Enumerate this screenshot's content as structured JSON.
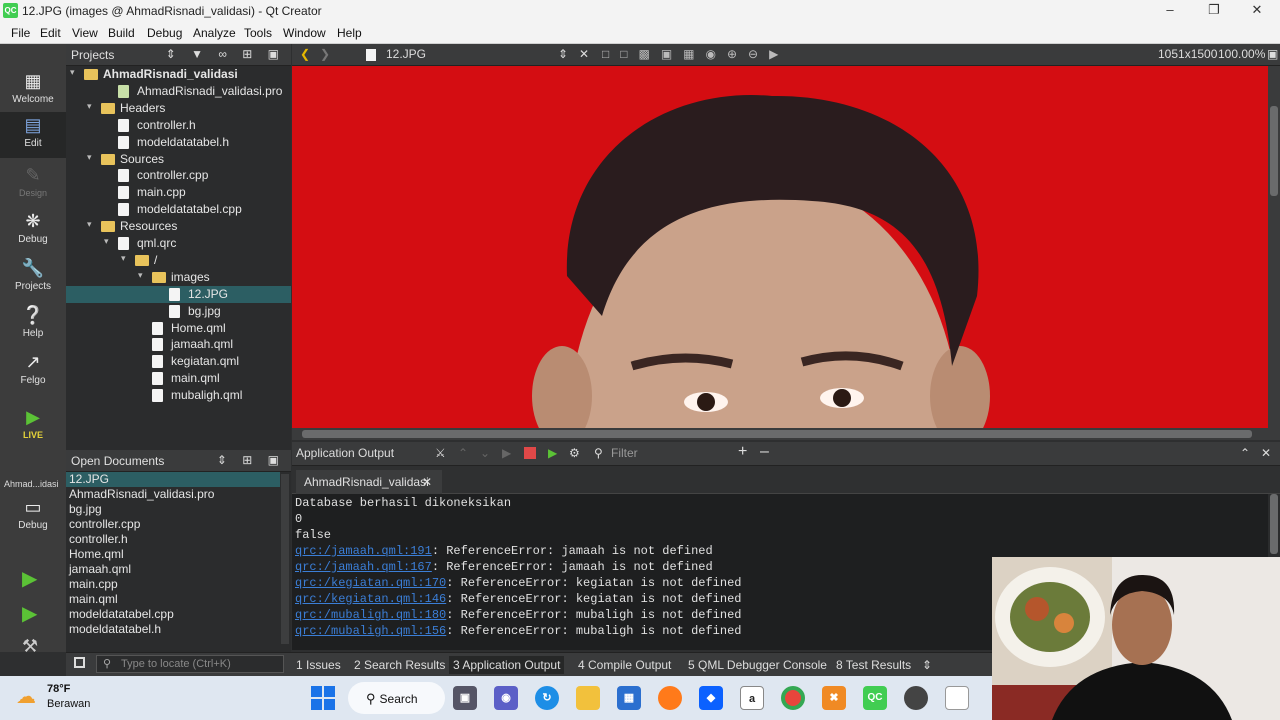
{
  "window": {
    "app_icon": "QC",
    "title": "12.JPG (images @ AhmadRisnadi_validasi) - Qt Creator"
  },
  "menu": [
    "File",
    "Edit",
    "View",
    "Build",
    "Debug",
    "Analyze",
    "Tools",
    "Window",
    "Help"
  ],
  "modes": {
    "welcome": "Welcome",
    "edit": "Edit",
    "design": "Design",
    "debug": "Debug",
    "projects": "Projects",
    "help": "Help",
    "felgo": "Felgo",
    "live": "LIVE",
    "kit_name": "Ahmad...idasi",
    "kit_mode": "Debug"
  },
  "projects_pane": {
    "title": "Projects",
    "tree": [
      {
        "label": "AhmadRisnadi_validasi",
        "bold": true
      },
      {
        "label": "AhmadRisnadi_validasi.pro"
      },
      {
        "label": "Headers"
      },
      {
        "label": "controller.h"
      },
      {
        "label": "modeldatatabel.h"
      },
      {
        "label": "Sources"
      },
      {
        "label": "controller.cpp"
      },
      {
        "label": "main.cpp"
      },
      {
        "label": "modeldatatabel.cpp"
      },
      {
        "label": "Resources"
      },
      {
        "label": "qml.qrc"
      },
      {
        "label": "/"
      },
      {
        "label": "images"
      },
      {
        "label": "12.JPG",
        "selected": true
      },
      {
        "label": "bg.jpg"
      },
      {
        "label": "Home.qml"
      },
      {
        "label": "jamaah.qml"
      },
      {
        "label": "kegiatan.qml"
      },
      {
        "label": "main.qml"
      },
      {
        "label": "mubaligh.qml"
      }
    ]
  },
  "open_documents": {
    "title": "Open Documents",
    "items": [
      "12.JPG",
      "AhmadRisnadi_validasi.pro",
      "bg.jpg",
      "controller.cpp",
      "controller.h",
      "Home.qml",
      "jamaah.qml",
      "main.cpp",
      "main.qml",
      "modeldatatabel.cpp",
      "modeldatatabel.h"
    ]
  },
  "editor": {
    "file_name": "12.JPG",
    "image_size": "1051x1500",
    "zoom": "100.00%"
  },
  "output_pane": {
    "title": "Application Output",
    "filter_placeholder": "Filter",
    "tab_label": "AhmadRisnadi_validasi",
    "lines": [
      {
        "text": "Database berhasil dikoneksikan"
      },
      {
        "text": "0"
      },
      {
        "text": "false"
      },
      {
        "link": "qrc:/jamaah.qml:191",
        "text": ": ReferenceError: jamaah is not defined"
      },
      {
        "link": "qrc:/jamaah.qml:167",
        "text": ": ReferenceError: jamaah is not defined"
      },
      {
        "link": "qrc:/kegiatan.qml:170",
        "text": ": ReferenceError: kegiatan is not defined"
      },
      {
        "link": "qrc:/kegiatan.qml:146",
        "text": ": ReferenceError: kegiatan is not defined"
      },
      {
        "link": "qrc:/mubaligh.qml:180",
        "text": ": ReferenceError: mubaligh is not defined"
      },
      {
        "link": "qrc:/mubaligh.qml:156",
        "text": ": ReferenceError: mubaligh is not defined"
      }
    ]
  },
  "bottom_tabs": [
    "1  Issues",
    "2  Search Results",
    "3  Application Output",
    "4  Compile Output",
    "5  QML Debugger Console",
    "8  Test Results"
  ],
  "locate_placeholder": "Type to locate (Ctrl+K)",
  "taskbar": {
    "weather_temp": "78°F",
    "weather_desc": "Berawan",
    "search_label": "Search"
  },
  "colors": {
    "image_background": "#d40d12",
    "selection": "#2c5e63",
    "link": "#3b7ed6"
  }
}
